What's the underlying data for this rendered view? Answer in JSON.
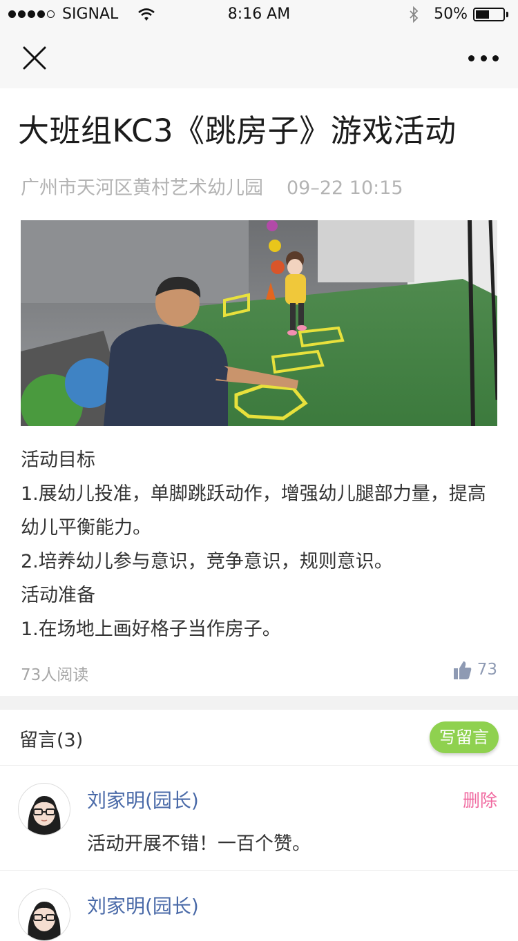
{
  "status_bar": {
    "carrier": "SIGNAL",
    "time": "8:16 AM",
    "battery": "50%",
    "battery_level": 0.5
  },
  "nav": {
    "close_icon": "close-icon",
    "more_icon": "more-icon"
  },
  "article": {
    "title": "大班组KC3《跳房子》游戏活动",
    "author": "广州市天河区黄村艺术幼儿园",
    "date": "09–22 10:15",
    "paragraphs": [
      "活动目标",
      "1.展幼儿投准，单脚跳跃动作，增强幼儿腿部力量，提高幼儿平衡能力。",
      "2.培养幼儿参与意识，竞争意识，规则意识。",
      "活动准备",
      "1.在场地上画好格子当作房子。"
    ],
    "read_count": "73人阅读",
    "like_count": "73"
  },
  "comments": {
    "title": "留言(3)",
    "write_label": "写留言",
    "items": [
      {
        "author": "刘家明(园长)",
        "delete_label": "删除",
        "text": "活动开展不错！一百个赞。"
      },
      {
        "author": "刘家明(园长)"
      }
    ]
  },
  "colors": {
    "accent_green": "#8fd14f",
    "author_blue": "#4a6aa8",
    "delete_pink": "#f06aa0"
  }
}
